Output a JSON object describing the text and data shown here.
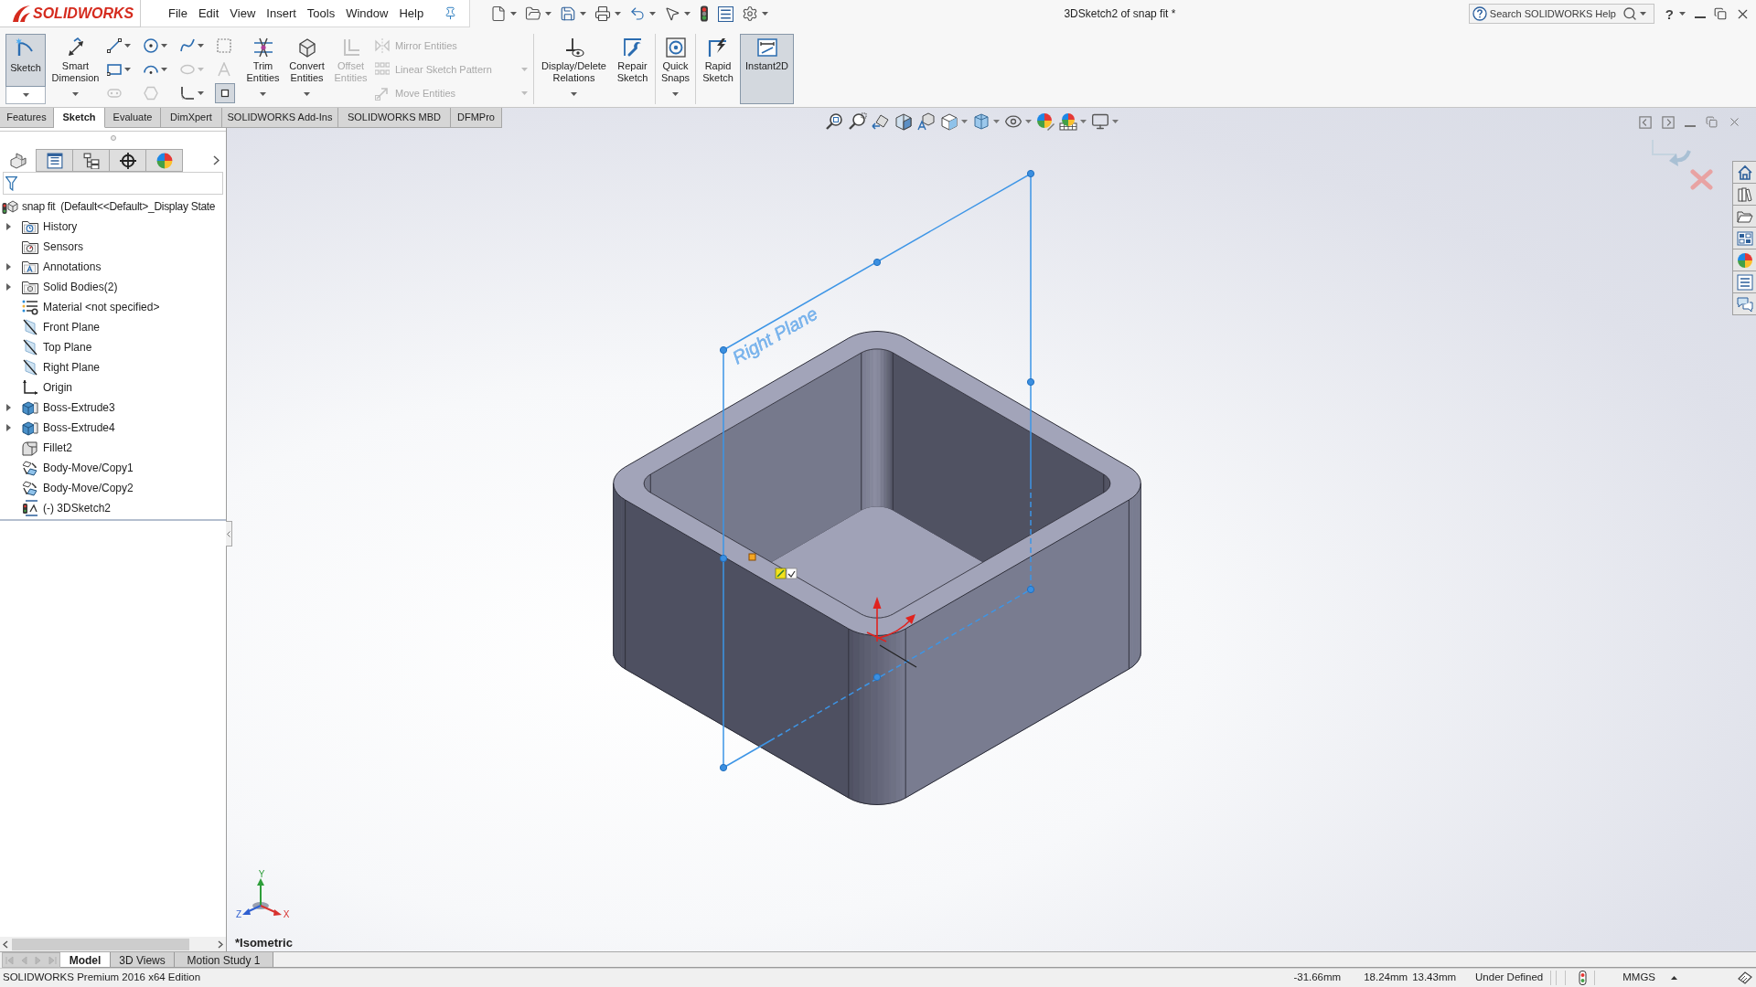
{
  "title_bar": {
    "logo": "SOLIDWORKS",
    "menu": [
      "File",
      "Edit",
      "View",
      "Insert",
      "Tools",
      "Window",
      "Help"
    ],
    "document_title": "3DSketch2 of snap fit *",
    "search": {
      "placeholder": "Search SOLIDWORKS Help"
    },
    "help_label": "?"
  },
  "command_manager": {
    "groups": [
      [
        {
          "kind": "split",
          "label": "Sketch",
          "pressed": true,
          "disabled": false,
          "dropdown": true
        },
        {
          "kind": "large",
          "label": "Smart Dimension",
          "pressed": false,
          "disabled": false,
          "dropdown": true
        },
        {
          "kind": "grid",
          "items": [
            {
              "pressed": false,
              "disabled": false,
              "dropdown": true
            },
            {
              "pressed": false,
              "disabled": false,
              "dropdown": true
            },
            {
              "pressed": false,
              "disabled": false,
              "dropdown": true
            },
            {
              "pressed": false,
              "disabled": false,
              "dropdown": false
            },
            {
              "pressed": false,
              "disabled": false,
              "dropdown": true
            },
            {
              "pressed": false,
              "disabled": false,
              "dropdown": true
            },
            {
              "pressed": false,
              "disabled": true,
              "dropdown": true
            },
            {
              "pressed": false,
              "disabled": true,
              "dropdown": false
            },
            {
              "pressed": false,
              "disabled": true,
              "dropdown": false
            },
            {
              "pressed": false,
              "disabled": true,
              "dropdown": false
            },
            {
              "pressed": false,
              "disabled": false,
              "dropdown": true
            },
            {
              "pressed": true,
              "disabled": false,
              "dropdown": false
            }
          ]
        },
        {
          "kind": "large",
          "label": "Trim Entities",
          "pressed": false,
          "disabled": false,
          "dropdown": true
        },
        {
          "kind": "large",
          "label": "Convert Entities",
          "pressed": false,
          "disabled": false,
          "dropdown": true
        },
        {
          "kind": "large",
          "label": "Offset Entities",
          "pressed": false,
          "disabled": true,
          "dropdown": false
        },
        {
          "kind": "stack",
          "items": [
            {
              "label": "Mirror Entities",
              "disabled": true,
              "dropdown": false
            },
            {
              "label": "Linear Sketch Pattern",
              "disabled": true,
              "dropdown": true
            },
            {
              "label": "Move Entities",
              "disabled": true,
              "dropdown": true
            }
          ]
        }
      ],
      [
        {
          "kind": "large",
          "label": "Display/Delete Relations",
          "pressed": false,
          "disabled": false,
          "dropdown": true
        },
        {
          "kind": "large",
          "label": "Repair Sketch",
          "pressed": false,
          "disabled": false,
          "dropdown": false
        }
      ],
      [
        {
          "kind": "large",
          "label": "Quick Snaps",
          "pressed": false,
          "disabled": false,
          "dropdown": true
        }
      ],
      [
        {
          "kind": "large",
          "label": "Rapid Sketch",
          "pressed": false,
          "disabled": false,
          "dropdown": false
        },
        {
          "kind": "large",
          "label": "Instant2D",
          "pressed": true,
          "disabled": false,
          "dropdown": false
        }
      ]
    ]
  },
  "feature_tabs": [
    {
      "label": "Features",
      "selected": false
    },
    {
      "label": "Sketch",
      "selected": true
    },
    {
      "label": "Evaluate",
      "selected": false
    },
    {
      "label": "DimXpert",
      "selected": false
    },
    {
      "label": "SOLIDWORKS Add-Ins",
      "selected": false
    },
    {
      "label": "SOLIDWORKS MBD",
      "selected": false
    },
    {
      "label": "DFMPro",
      "selected": false
    }
  ],
  "manager_tabs": [
    {
      "selected": true
    },
    {
      "selected": false
    },
    {
      "selected": false
    },
    {
      "selected": false
    },
    {
      "selected": false
    }
  ],
  "feature_tree": {
    "label": "snap fit  (Default<<Default>_Display State",
    "children": [
      {
        "label": "History",
        "kind": "history",
        "collapsed": true
      },
      {
        "label": "Sensors",
        "kind": "sensors",
        "collapsed": false
      },
      {
        "label": "Annotations",
        "kind": "annotations",
        "collapsed": true
      },
      {
        "label": "Solid Bodies(2)",
        "kind": "bodies",
        "collapsed": true
      },
      {
        "label": "Material <not specified>",
        "kind": "material",
        "collapsed": false
      },
      {
        "label": "Front Plane",
        "kind": "plane",
        "collapsed": false
      },
      {
        "label": "Top Plane",
        "kind": "plane",
        "collapsed": false
      },
      {
        "label": "Right Plane",
        "kind": "plane",
        "collapsed": false
      },
      {
        "label": "Origin",
        "kind": "origin",
        "collapsed": false
      },
      {
        "label": "Boss-Extrude3",
        "kind": "extrude",
        "collapsed": true
      },
      {
        "label": "Boss-Extrude4",
        "kind": "extrude",
        "collapsed": true
      },
      {
        "label": "Fillet2",
        "kind": "fillet",
        "collapsed": false
      },
      {
        "label": "Body-Move/Copy1",
        "kind": "movecopy",
        "collapsed": false
      },
      {
        "label": "Body-Move/Copy2",
        "kind": "movecopy",
        "collapsed": false
      },
      {
        "label": "(-) 3DSketch2",
        "kind": "sketch",
        "collapsed": false
      }
    ]
  },
  "graphics": {
    "plane_label": "Right Plane",
    "view_name": "*Isometric",
    "triad": {
      "y": "Y",
      "z": "Z",
      "x": "X"
    }
  },
  "bottom_tabs": [
    {
      "label": "Model",
      "selected": true
    },
    {
      "label": "3D Views",
      "selected": false
    },
    {
      "label": "Motion Study 1",
      "selected": false
    }
  ],
  "status_bar": {
    "edition": "SOLIDWORKS Premium 2016 x64 Edition",
    "coordinates": [
      "-31.66mm",
      "18.24mm",
      "13.43mm"
    ],
    "sketch_state": "Under Defined",
    "units": "MMGS"
  }
}
